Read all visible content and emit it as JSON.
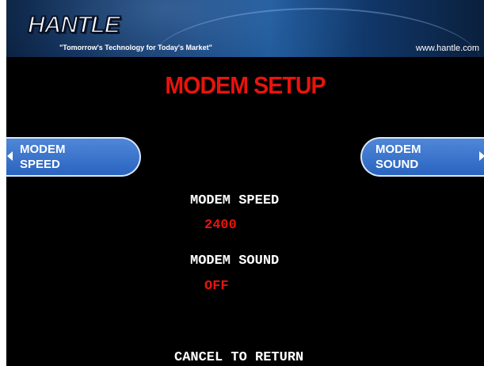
{
  "header": {
    "logo_text": "HANTLE",
    "tagline": "\"Tomorrow's Technology for Today's Market\"",
    "website": "www.hantle.com"
  },
  "title": "MODEM SETUP",
  "buttons": {
    "left": {
      "line1": "MODEM",
      "line2": "SPEED"
    },
    "right": {
      "line1": "MODEM",
      "line2": "SOUND"
    }
  },
  "settings": {
    "modem_speed": {
      "label": "MODEM SPEED",
      "value": "2400"
    },
    "modem_sound": {
      "label": "MODEM SOUND",
      "value": "OFF"
    }
  },
  "footer": "CANCEL TO RETURN",
  "colors": {
    "background": "#000000",
    "title": "#e8140c",
    "value": "#e8140c",
    "button": "#3a74cc",
    "header": "#11386a"
  }
}
